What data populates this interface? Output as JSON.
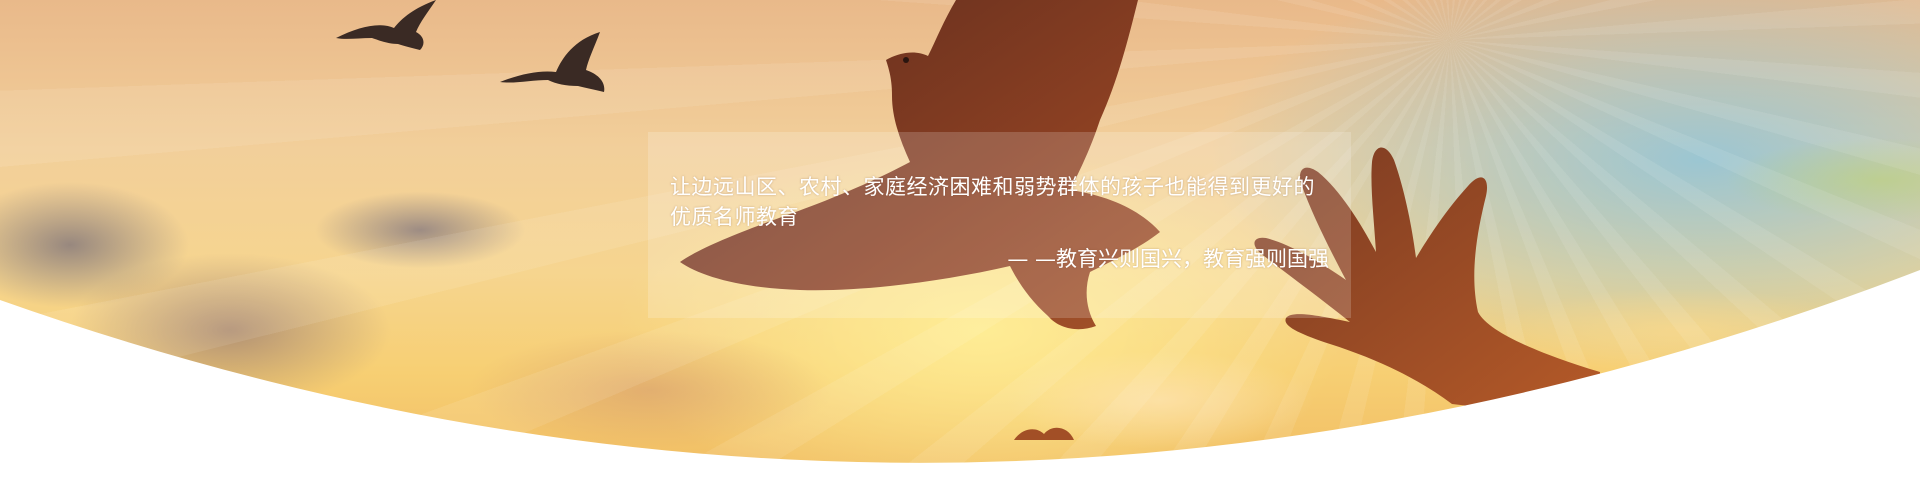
{
  "banner": {
    "quote": "让边远山区、农村、家庭经济困难和弱势群体的孩子也能得到更好的优质名师教育",
    "source": "— —教育兴则国兴，教育强则国强"
  },
  "colors": {
    "sky_warm": "#f2cf9a",
    "silhouette": "#6a3322",
    "panel_tint": "#ffffff"
  },
  "icons": [
    "bird-icon",
    "dove-icon",
    "hand-icon"
  ]
}
